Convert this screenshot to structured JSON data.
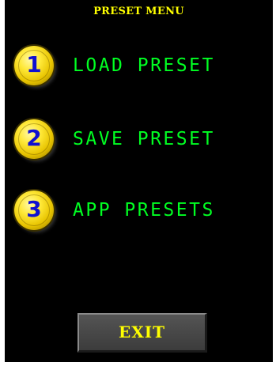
{
  "colors": {
    "screen_background": "#000000",
    "title_text": "#ffff00",
    "menu_text": "#00ff22",
    "number_text": "#1010d0",
    "exit_text": "#ffff00",
    "exit_background": "#474747"
  },
  "header": {
    "title": "PRESET MENU"
  },
  "menu": {
    "items": [
      {
        "number": "1",
        "label": "LOAD PRESET",
        "icon": "yellow-circle-button"
      },
      {
        "number": "2",
        "label": "SAVE PRESET",
        "icon": "yellow-circle-button"
      },
      {
        "number": "3",
        "label": "APP PRESETS",
        "icon": "yellow-circle-button"
      }
    ]
  },
  "footer": {
    "exit_label": "EXIT"
  }
}
